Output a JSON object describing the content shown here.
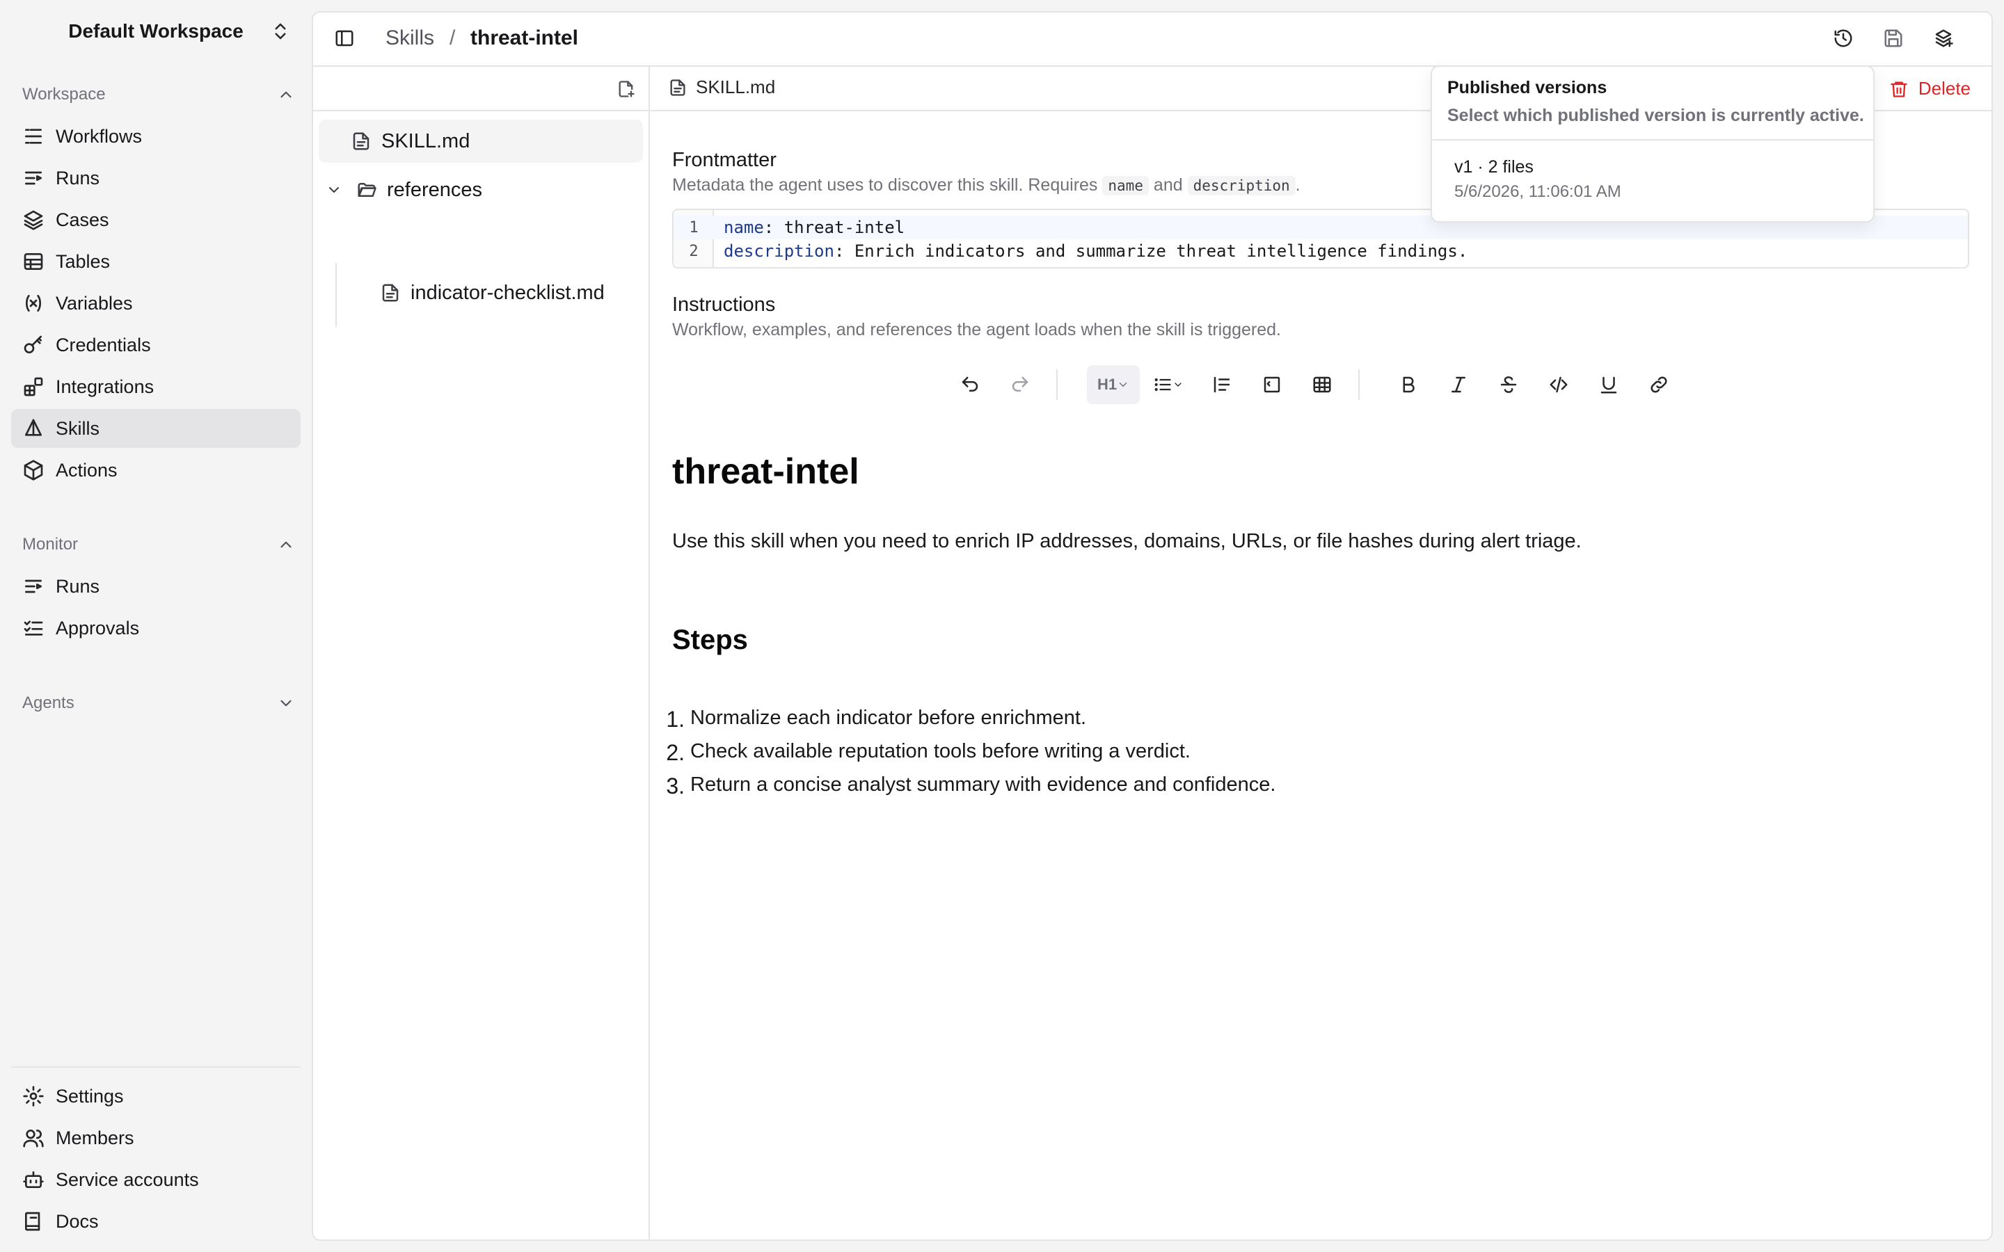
{
  "workspace_switcher": {
    "name": "Default Workspace",
    "icon": "chevrons-up-down-icon"
  },
  "sidebar": {
    "workspace_section": {
      "label": "Workspace",
      "items": [
        {
          "label": "Workflows",
          "icon": "workflow-icon"
        },
        {
          "label": "Runs",
          "icon": "runs-icon"
        },
        {
          "label": "Cases",
          "icon": "layers-icon"
        },
        {
          "label": "Tables",
          "icon": "table-icon"
        },
        {
          "label": "Variables",
          "icon": "variable-icon"
        },
        {
          "label": "Credentials",
          "icon": "key-icon"
        },
        {
          "label": "Integrations",
          "icon": "blocks-icon"
        },
        {
          "label": "Skills",
          "icon": "skills-icon",
          "active": true
        },
        {
          "label": "Actions",
          "icon": "box-icon"
        }
      ]
    },
    "monitor_section": {
      "label": "Monitor",
      "items": [
        {
          "label": "Runs",
          "icon": "runs-icon"
        },
        {
          "label": "Approvals",
          "icon": "list-checks-icon"
        }
      ]
    },
    "agents_section": {
      "label": "Agents",
      "collapsed": true
    },
    "footer_items": [
      {
        "label": "Settings",
        "icon": "gear-icon"
      },
      {
        "label": "Members",
        "icon": "users-icon"
      },
      {
        "label": "Service accounts",
        "icon": "bot-icon"
      },
      {
        "label": "Docs",
        "icon": "book-icon"
      }
    ]
  },
  "header": {
    "breadcrumb_parent": "Skills",
    "breadcrumb_separator": "/",
    "breadcrumb_current": "threat-intel",
    "actions": [
      "history-icon",
      "save-icon",
      "publish-icon"
    ]
  },
  "file_tree": {
    "files": [
      {
        "name": "SKILL.md",
        "type": "file",
        "selected": true
      },
      {
        "name": "references",
        "type": "folder",
        "expanded": true
      },
      {
        "name": "indicator-checklist.md",
        "type": "file",
        "parent": "references"
      }
    ]
  },
  "editor": {
    "tab_file": "SKILL.md",
    "delete_label": "Delete",
    "frontmatter": {
      "title": "Frontmatter",
      "subtitle_before": "Metadata the agent uses to discover this skill. Requires",
      "code_name": "name",
      "subtitle_and": "and",
      "code_description": "description",
      "subtitle_end": ".",
      "lines": [
        {
          "num": "1",
          "key": "name",
          "value": "threat-intel"
        },
        {
          "num": "2",
          "key": "description",
          "value": "Enrich indicators and summarize threat intelligence findings."
        }
      ]
    },
    "instructions": {
      "title": "Instructions",
      "subtitle": "Workflow, examples, and references the agent loads when the skill is triggered."
    },
    "toolbar": {
      "heading_label": "H1"
    },
    "document": {
      "h1": "threat-intel",
      "paragraph": "Use this skill when you need to enrich IP addresses, domains, URLs, or file hashes during alert triage.",
      "h2": "Steps",
      "steps": [
        {
          "num": "1.",
          "text": "Normalize each indicator before enrichment."
        },
        {
          "num": "2.",
          "text": "Check available reputation tools before writing a verdict."
        },
        {
          "num": "3.",
          "text": "Return a concise analyst summary with evidence and confidence."
        }
      ]
    }
  },
  "versions_popover": {
    "title": "Published versions",
    "subtitle": "Select which published version is currently active.",
    "versions": [
      {
        "label": "v1 · 2 files",
        "date": "5/6/2026, 11:06:01 AM"
      }
    ]
  },
  "colors": {
    "accent_danger": "#dc2626",
    "active_nav_bg": "#e4e4e7",
    "code_key": "#1e3a8a"
  }
}
